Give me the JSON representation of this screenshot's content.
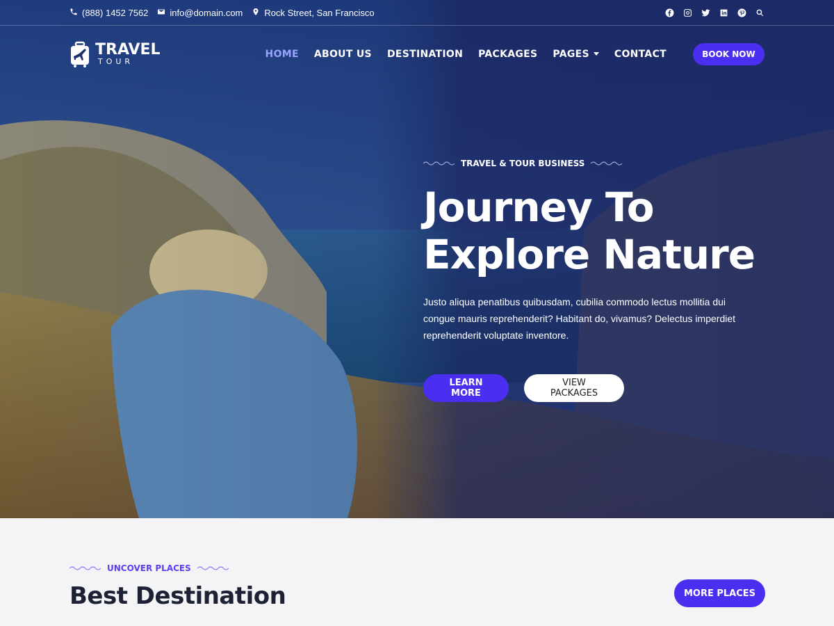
{
  "topbar": {
    "phone": "(888) 1452 7562",
    "email": "info@domain.com",
    "address": "Rock Street, San Francisco",
    "social_icons": [
      "facebook-icon",
      "instagram-icon",
      "twitter-icon",
      "linkedin-icon",
      "pinterest-icon",
      "search-icon"
    ]
  },
  "logo": {
    "line1": "TRAVEL",
    "line2": "TOUR"
  },
  "nav": {
    "items": [
      {
        "label": "HOME",
        "active": true
      },
      {
        "label": "ABOUT US"
      },
      {
        "label": "DESTINATION"
      },
      {
        "label": "PACKAGES"
      },
      {
        "label": "PAGES",
        "has_dropdown": true
      },
      {
        "label": "CONTACT"
      }
    ],
    "book_label": "BOOK NOW"
  },
  "hero": {
    "kicker": "TRAVEL & TOUR BUSINESS",
    "headline_line1": "Journey To",
    "headline_line2": "Explore Nature",
    "description": "Justo aliqua penatibus quibusdam, cubilia commodo lectus mollitia dui congue mauris reprehenderit? Habitant do, vivamus? Delectus imperdiet reprehenderit voluptate inventore.",
    "learn_more": "LEARN MORE",
    "view_packages": "VIEW PACKAGES"
  },
  "section": {
    "kicker": "UNCOVER PLACES",
    "title": "Best Destination",
    "more_label": "MORE PLACES"
  },
  "colors": {
    "accent": "#4b2ff0",
    "nav_active": "#9aa2ff",
    "section_bg": "#f4f4f6",
    "title": "#1c2233"
  }
}
